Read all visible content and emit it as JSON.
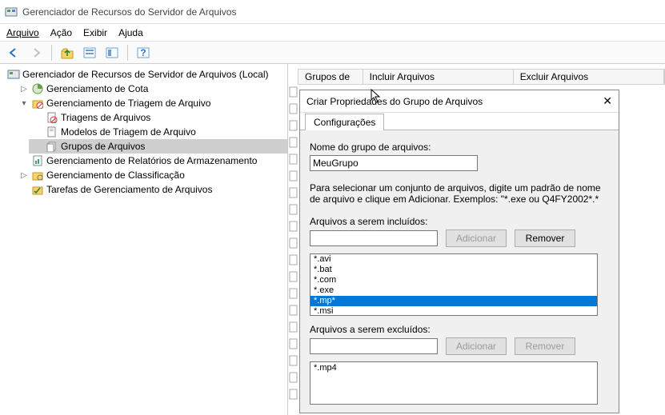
{
  "window": {
    "title": "Gerenciador de Recursos do Servidor de Arquivos"
  },
  "menu": {
    "arquivo": "Arquivo",
    "acao": "Ação",
    "exibir": "Exibir",
    "ajuda": "Ajuda"
  },
  "tree": {
    "root": "Gerenciador de Recursos de Servidor de Arquivos (Local)",
    "n1": "Gerenciamento de Cota",
    "n2": "Gerenciamento de Triagem de Arquivo",
    "n2a": "Triagens de Arquivos",
    "n2b": "Modelos de Triagem de Arquivo",
    "n2c": "Grupos de Arquivos",
    "n3": "Gerenciamento de Relatórios de Armazenamento",
    "n4": "Gerenciamento de Classificação",
    "n5": "Tarefas de Gerenciamento de Arquivos"
  },
  "columns": {
    "c1": "Grupos de ...",
    "c2": "Incluir Arquivos",
    "c3": "Excluir Arquivos"
  },
  "dialog": {
    "title": "Criar Propriedades do Grupo de Arquivos",
    "tab": "Configurações",
    "name_label": "Nome do grupo de arquivos:",
    "name_value": "MeuGrupo",
    "help1": "Para selecionar um conjunto de arquivos, digite um padrão de nome",
    "help2": "de arquivo e clique em Adicionar. Exemplos: \"*.exe ou Q4FY2002*.*",
    "include_label": "Arquivos a serem incluídos:",
    "exclude_label": "Arquivos a serem excluídos:",
    "add": "Adicionar",
    "remove": "Remover",
    "include_items": [
      "*.avi",
      "*.bat",
      "*.com",
      "*.exe",
      "*.mp*",
      "*.msi"
    ],
    "include_selected_index": 4,
    "exclude_items": [
      "*.mp4"
    ]
  }
}
